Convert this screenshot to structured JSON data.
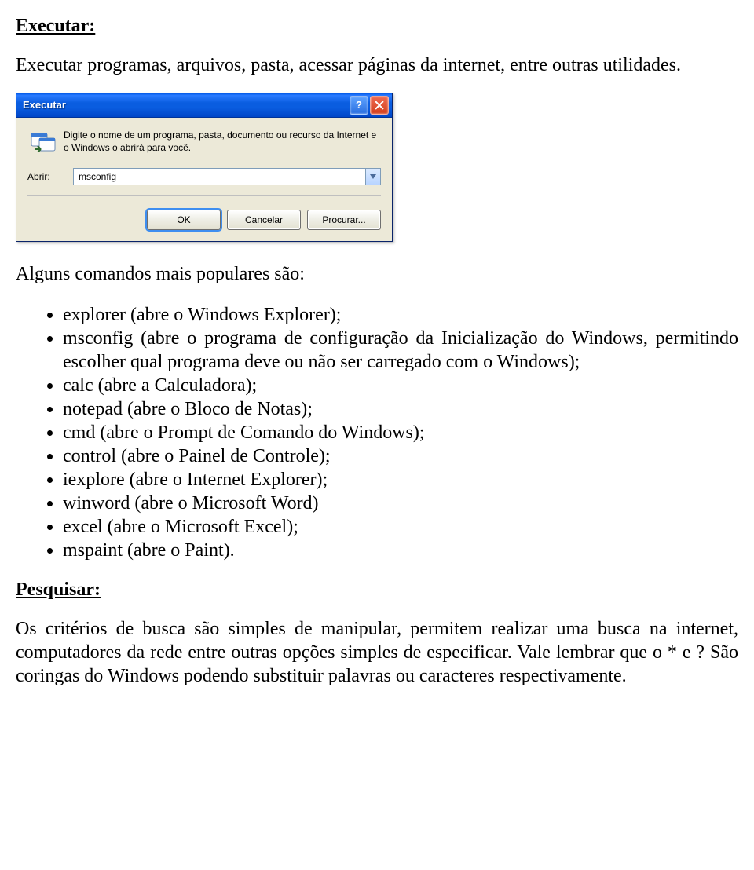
{
  "heading1": "Executar:",
  "intro": "Executar programas, arquivos, pasta, acessar páginas da internet, entre outras utilidades.",
  "dialog": {
    "title": "Executar",
    "help_char": "?",
    "desc": "Digite o nome de um programa, pasta, documento ou recurso da Internet e o Windows o abrirá para você.",
    "open_label_prefix": "A",
    "open_label_rest": "brir:",
    "value": "msconfig",
    "btn_ok": "OK",
    "btn_cancel": "Cancelar",
    "btn_browse": "Procurar..."
  },
  "list_intro": "Alguns comandos mais populares são:",
  "bullets": [
    "explorer (abre o Windows Explorer);",
    "msconfig (abre o programa de configuração da Inicialização do Windows, permitindo escolher qual programa deve ou não ser carregado com o Windows);",
    "calc (abre a Calculadora);",
    "notepad (abre o Bloco de Notas);",
    "cmd (abre o Prompt de Comando do Windows);",
    "control (abre o Painel de Controle);",
    "iexplore (abre o Internet Explorer);",
    "winword (abre o Microsoft Word)",
    "excel (abre o Microsoft Excel);",
    "mspaint (abre o Paint)."
  ],
  "heading2": "Pesquisar:",
  "para2": "Os critérios de busca são simples de manipular, permitem realizar uma busca na internet, computadores da rede entre outras opções simples de especificar. Vale lembrar que o * e ? São coringas do Windows podendo substituir palavras ou caracteres respectivamente."
}
